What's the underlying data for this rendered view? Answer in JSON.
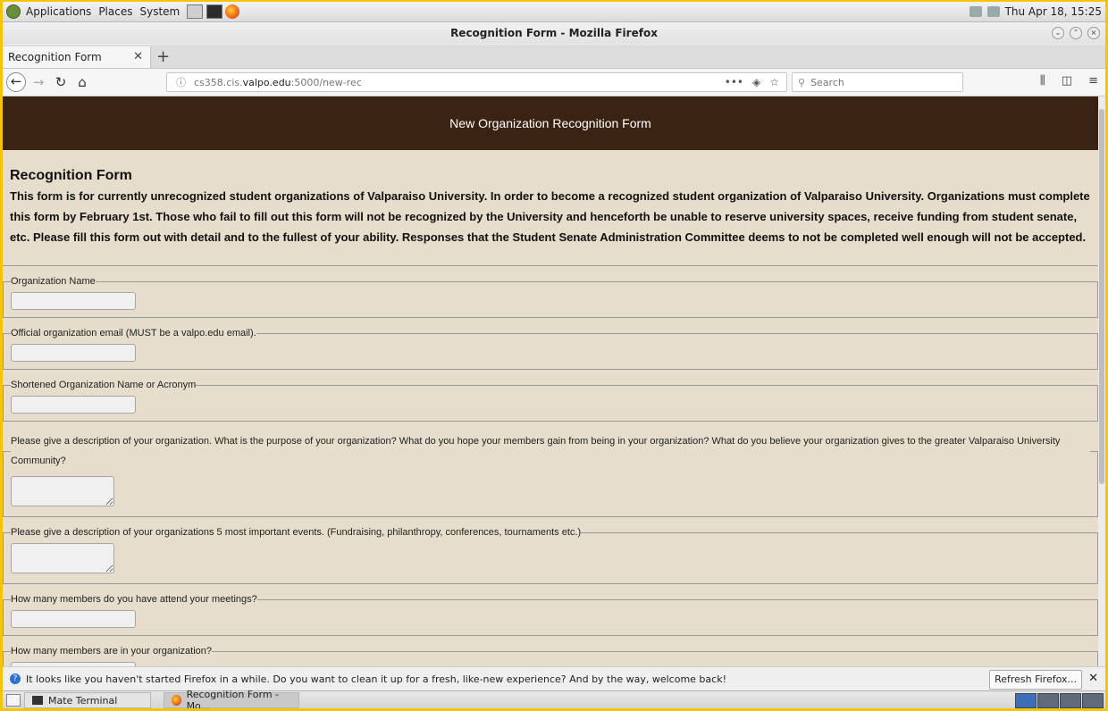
{
  "desktop": {
    "menu": [
      "Applications",
      "Places",
      "System"
    ],
    "clock": "Thu Apr 18, 15:25"
  },
  "window": {
    "title": "Recognition Form - Mozilla Firefox"
  },
  "tabs": [
    {
      "label": "Recognition Form"
    }
  ],
  "navbar": {
    "url_prefix": "cs358.cis.",
    "url_domain": "valpo.edu",
    "url_suffix": ":5000/new-rec",
    "search_placeholder": "Search"
  },
  "page": {
    "header": "New Organization Recognition Form",
    "intro_title": "Recognition Form",
    "intro_text": "This form is for currently unrecognized student organizations of Valparaiso University. In order to become a recognized student organization of Valparaiso University. Organizations must complete this form by February 1st. Those who fail to fill out this form will not be recognized by the University and henceforth be unable to reserve university spaces, receive funding from student senate, etc. Please fill this form out with detail and to the fullest of your ability. Responses that the Student Senate Administration Committee deems to not be completed well enough will not be accepted.",
    "fields": [
      {
        "label": "Organization Name",
        "value": ""
      },
      {
        "label": "Official organization email (MUST be a valpo.edu email).",
        "value": ""
      },
      {
        "label": "Shortened Organization Name or Acronym",
        "value": ""
      },
      {
        "label": "Please give a description of your organization. What is the purpose of your organization? What do you hope your members gain from being in your organization? What do you believe your organization gives to the greater Valparaiso University Community?",
        "value": ""
      },
      {
        "label": "Please give a description of your organizations 5 most important events. (Fundraising, philanthropy, conferences, tournaments etc.)",
        "value": ""
      },
      {
        "label": "How many members do you have attend your meetings?",
        "value": ""
      },
      {
        "label": "How many members are in your organization?",
        "value": ""
      }
    ]
  },
  "notification": {
    "text": "It looks like you haven't started Firefox in a while. Do you want to clean it up for a fresh, like-new experience? And by the way, welcome back!",
    "button": "Refresh Firefox..."
  },
  "taskbar": {
    "items": [
      "Mate Terminal",
      "Recognition Form - Mo..."
    ]
  }
}
